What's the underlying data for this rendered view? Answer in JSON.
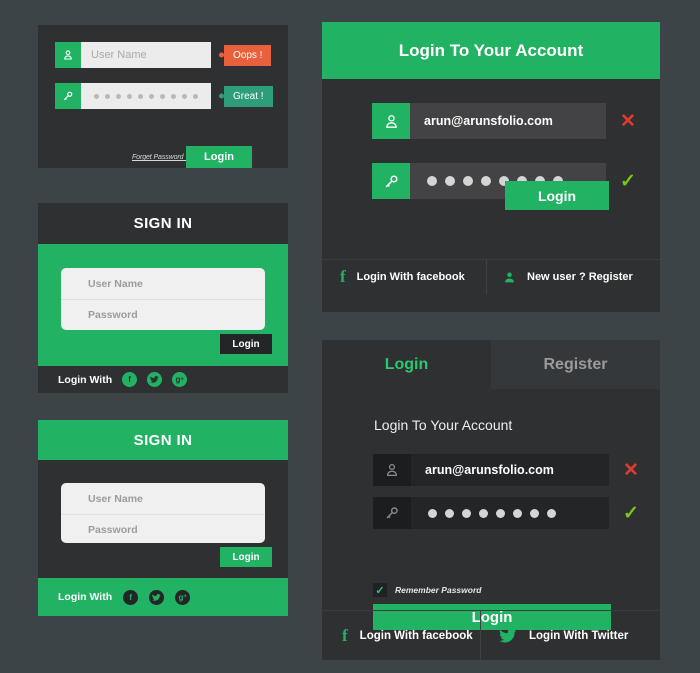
{
  "theme": {
    "page_bg": "#3c4447",
    "panel_dark": "#2e3032",
    "accent_green": "#21b263",
    "error_orange": "#e8603c",
    "success_teal": "#2d9e79",
    "error_red": "#e03b2f",
    "success_green": "#7bc41c",
    "tab_active_green": "#2bc96f"
  },
  "panel1": {
    "username": {
      "placeholder": "User Name",
      "icon": "user-icon",
      "badge": "Oops !"
    },
    "password": {
      "icon": "key-icon",
      "badge": "Great !",
      "dots": 10
    },
    "forgot_label": "Forget Password ?",
    "login_label": "Login"
  },
  "panel2": {
    "title": "SIGN IN",
    "username_placeholder": "User Name",
    "password_placeholder": "Password",
    "login_label": "Login",
    "footer_label": "Login With",
    "socials": [
      "facebook-icon",
      "twitter-icon",
      "google-plus-icon"
    ]
  },
  "panel3": {
    "title": "SIGN IN",
    "username_placeholder": "User Name",
    "password_placeholder": "Password",
    "login_label": "Login",
    "footer_label": "Login With",
    "socials": [
      "facebook-icon",
      "twitter-icon",
      "google-plus-icon"
    ]
  },
  "panel4": {
    "title": "Login To Your Account",
    "email_value": "arun@arunsfolio.com",
    "email_icon": "user-icon",
    "email_status": "✕",
    "password_icon": "key-icon",
    "password_dots": 8,
    "password_status": "✓",
    "login_label": "Login",
    "footer": {
      "facebook_label": "Login With facebook",
      "facebook_icon": "facebook-icon",
      "register_label": "New user ? Register",
      "register_icon": "user-silhouette-icon"
    }
  },
  "panel5": {
    "tabs": [
      {
        "label": "Login",
        "active": true
      },
      {
        "label": "Register",
        "active": false
      }
    ],
    "heading": "Login To Your Account",
    "email_value": "arun@arunsfolio.com",
    "email_icon": "user-icon",
    "email_status": "✕",
    "password_icon": "key-icon",
    "password_dots": 8,
    "password_status": "✓",
    "remember_label": "Remember Password",
    "remember_checked": "✓",
    "login_label": "Login",
    "footer": {
      "facebook_label": "Login With facebook",
      "facebook_icon": "facebook-icon",
      "twitter_label": "Login With Twitter",
      "twitter_icon": "twitter-icon"
    }
  }
}
